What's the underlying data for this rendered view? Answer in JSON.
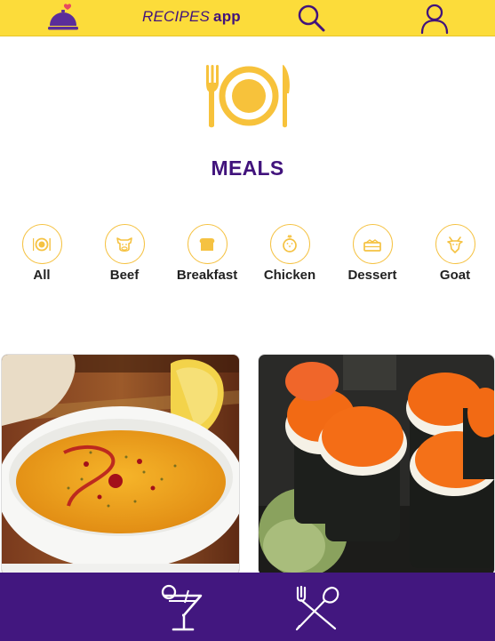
{
  "header": {
    "title_main": "RECIPES",
    "title_app": "app",
    "logo_icon": "cloche-heart-icon",
    "search_icon": "search-icon",
    "profile_icon": "profile-icon"
  },
  "main": {
    "hero_icon": "plate-fork-knife-icon",
    "title": "MEALS",
    "categories": [
      {
        "label": "All",
        "icon": "plate-icon"
      },
      {
        "label": "Beef",
        "icon": "cow-icon"
      },
      {
        "label": "Breakfast",
        "icon": "bread-icon"
      },
      {
        "label": "Chicken",
        "icon": "chicken-icon"
      },
      {
        "label": "Dessert",
        "icon": "cake-icon"
      },
      {
        "label": "Goat",
        "icon": "goat-icon"
      }
    ],
    "cards": [
      {
        "image": "lentil-soup-photo"
      },
      {
        "image": "sushi-roll-photo"
      }
    ]
  },
  "footer": {
    "drinks_icon": "cocktail-icon",
    "meals_icon": "fork-spoon-crossed-icon"
  },
  "colors": {
    "header_bg": "#fcdc3a",
    "brand_purple": "#41137c",
    "footer_bg": "#42177f",
    "accent_yellow": "#f5c242"
  }
}
